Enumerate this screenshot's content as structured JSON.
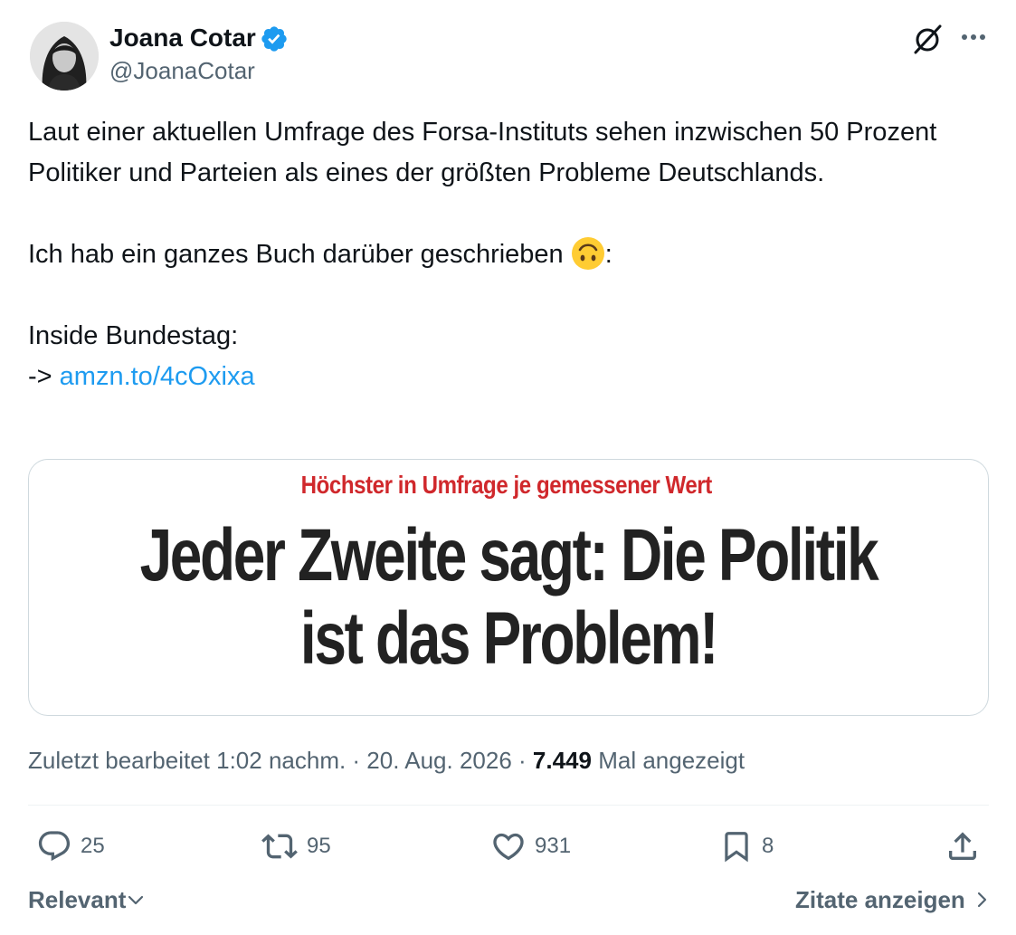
{
  "author": {
    "name": "Joana Cotar",
    "handle": "@JoanaCotar"
  },
  "icons": {
    "avatar": "profile-photo",
    "verified": "verified-badge-icon",
    "grok": "grok-icon",
    "more": "more-dots-icon",
    "emoji": "upside-down-face-emoji",
    "reply": "reply-bubble-icon",
    "repost": "repost-icon",
    "like": "heart-icon",
    "bookmark": "bookmark-icon",
    "share": "share-upload-icon"
  },
  "colors": {
    "link": "#1d9bf0",
    "verified": "#1d9bf0",
    "kicker_red": "#d0282c",
    "muted": "#536471"
  },
  "tweet": {
    "paragraph1": "Laut einer aktuellen Umfrage des Forsa-Instituts sehen inzwischen 50 Prozent Politiker und Parteien als eines der größten Probleme Deutschlands.",
    "paragraph2": "Ich hab ein ganzes Buch darüber geschrieben",
    "paragraph2_suffix": ":",
    "paragraph3_line1": "Inside Bundestag:",
    "paragraph3_arrow": "->",
    "link_text": "amzn.to/4cOxixa"
  },
  "media": {
    "kicker": "Höchster in Umfrage je gemessener Wert",
    "headline_line1": "Jeder Zweite sagt: Die Politik",
    "headline_line2": "ist das Problem!"
  },
  "meta": {
    "edited": "Zuletzt bearbeitet 1:02 nachm. · 20. Aug. 2026 ·",
    "views_count": "7.449",
    "views_label": "Mal angezeigt"
  },
  "actions": {
    "replies": "25",
    "reposts": "95",
    "likes": "931",
    "bookmarks": "8"
  },
  "footer": {
    "sort_label": "Relevant",
    "quotes_label": "Zitate anzeigen"
  }
}
